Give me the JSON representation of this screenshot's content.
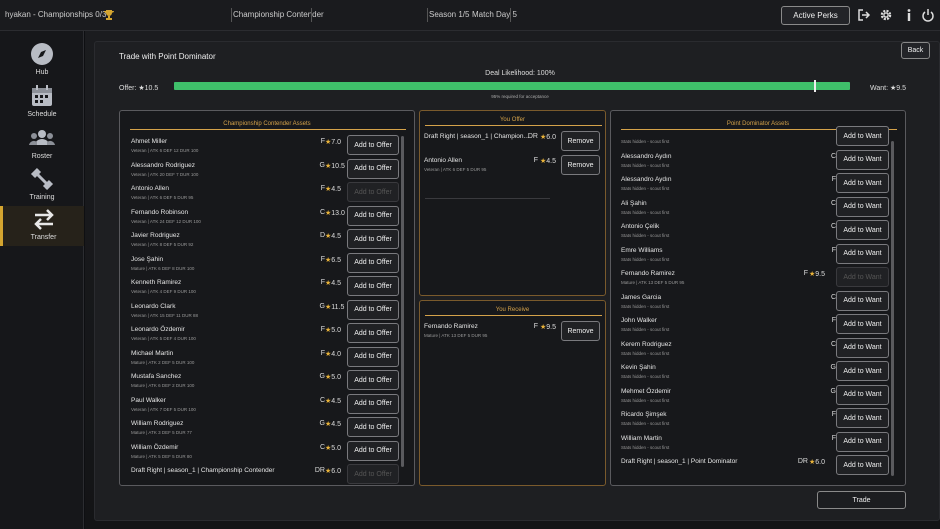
{
  "topbar": {
    "user": "hyakan - Championships 0/3",
    "club": "Championship Contender",
    "season": "Season 1/5",
    "matchday": "Match Day 5",
    "perks_label": "Active Perks"
  },
  "sidebar": [
    {
      "label": "Hub",
      "icon": "compass-icon"
    },
    {
      "label": "Schedule",
      "icon": "calendar-icon"
    },
    {
      "label": "Roster",
      "icon": "users-icon"
    },
    {
      "label": "Training",
      "icon": "dumbbell-icon"
    },
    {
      "label": "Transfer",
      "icon": "swap-arrows-icon",
      "active": true
    }
  ],
  "modal": {
    "title": "Trade with Point Dominator",
    "back_label": "Back",
    "likelihood": "Deal Likelihood: 100%",
    "likelihood_value": 1.0,
    "offer_label": "Offer: ★10.5",
    "want_label": "Want: ★9.5",
    "required_text": "95% required for acceptance",
    "required_value": 0.95,
    "trade_label": "Trade"
  },
  "left_panel": {
    "title": "Championship Contender Assets",
    "button_label": "Add to Offer",
    "rows": [
      {
        "name": "Ahmet Miller",
        "stats": "Veteran | ATK 6 DEF 12 DUR 100",
        "pos": "F",
        "rating": "★7.0",
        "disabled": false
      },
      {
        "name": "Alessandro Rodriguez",
        "stats": "Veteran | ATK 20 DEF 7 DUR 100",
        "pos": "G",
        "rating": "★10.5",
        "disabled": false
      },
      {
        "name": "Antonio Allen",
        "stats": "Veteran | ATK 6 DEF 5 DUR 95",
        "pos": "F",
        "rating": "★4.5",
        "disabled": true
      },
      {
        "name": "Fernando Robinson",
        "stats": "Veteran | ATK 24 DEF 12 DUR 100",
        "pos": "C",
        "rating": "★13.0",
        "disabled": false
      },
      {
        "name": "Javier Rodriguez",
        "stats": "Veteran | ATK 8 DEF 5 DUR 92",
        "pos": "D",
        "rating": "★4.5",
        "disabled": false
      },
      {
        "name": "Jose Şahin",
        "stats": "Mature | ATK 6 DEF 8 DUR 100",
        "pos": "F",
        "rating": "★6.5",
        "disabled": false
      },
      {
        "name": "Kenneth Ramirez",
        "stats": "Veteran | ATK 4 DEF 9 DUR 100",
        "pos": "F",
        "rating": "★4.5",
        "disabled": false
      },
      {
        "name": "Leonardo Clark",
        "stats": "Veteran | ATK 15 DEF 11 DUR 88",
        "pos": "G",
        "rating": "★11.5",
        "disabled": false
      },
      {
        "name": "Leonardo Özdemir",
        "stats": "Veteran | ATK 5 DEF 4 DUR 100",
        "pos": "F",
        "rating": "★5.0",
        "disabled": false
      },
      {
        "name": "Michael Martin",
        "stats": "Mature | ATK 2 DEF 5 DUR 100",
        "pos": "F",
        "rating": "★4.0",
        "disabled": false
      },
      {
        "name": "Mustafa Sanchez",
        "stats": "Mature | ATK 6 DEF 2 DUR 100",
        "pos": "G",
        "rating": "★5.0",
        "disabled": false
      },
      {
        "name": "Paul Walker",
        "stats": "Veteran | ATK 7 DEF 5 DUR 100",
        "pos": "C",
        "rating": "★4.5",
        "disabled": false
      },
      {
        "name": "William Rodriguez",
        "stats": "Mature | ATK 3 DEF 5 DUR 77",
        "pos": "G",
        "rating": "★4.5",
        "disabled": false
      },
      {
        "name": "William Özdemir",
        "stats": "Mature | ATK 5 DEF 5 DUR 80",
        "pos": "C",
        "rating": "★5.0",
        "disabled": false
      },
      {
        "name": "Draft Right | season_1 | Championship Contender",
        "stats": "",
        "pos": "DR",
        "rating": "★6.0",
        "disabled": true
      }
    ]
  },
  "offer_panel": {
    "title": "You Offer",
    "button_label": "Remove",
    "rows": [
      {
        "name": "Draft Right | season_1 | Champion...",
        "stats": "",
        "pos": "DR",
        "rating": "★6.0"
      },
      {
        "name": "Antonio Allen",
        "stats": "Veteran | ATK 6 DEF 5 DUR 95",
        "pos": "F",
        "rating": "★4.5"
      }
    ]
  },
  "receive_panel": {
    "title": "You Receive",
    "button_label": "Remove",
    "rows": [
      {
        "name": "Fernando Ramirez",
        "stats": "Mature | ATK 13 DEF 5 DUR 95",
        "pos": "F",
        "rating": "★9.5"
      }
    ]
  },
  "right_panel": {
    "title": "Point Dominator Assets",
    "button_label": "Add to Want",
    "rows": [
      {
        "name": "",
        "stats": "Stats hidden - scout first",
        "pos": "",
        "rating": "",
        "disabled": false
      },
      {
        "name": "Alessandro Aydın",
        "stats": "Stats hidden - scout first",
        "pos": "C",
        "rating": "",
        "disabled": false
      },
      {
        "name": "Alessandro Aydın",
        "stats": "Stats hidden - scout first",
        "pos": "F",
        "rating": "",
        "disabled": false
      },
      {
        "name": "Ali Şahin",
        "stats": "Stats hidden - scout first",
        "pos": "C",
        "rating": "",
        "disabled": false
      },
      {
        "name": "Antonio Çelik",
        "stats": "Stats hidden - scout first",
        "pos": "C",
        "rating": "",
        "disabled": false
      },
      {
        "name": "Emre Williams",
        "stats": "Stats hidden - scout first",
        "pos": "F",
        "rating": "",
        "disabled": false
      },
      {
        "name": "Fernando Ramirez",
        "stats": "Mature | ATK 13 DEF 5 DUR 95",
        "pos": "F",
        "rating": "★9.5",
        "disabled": true
      },
      {
        "name": "James Garcia",
        "stats": "Stats hidden - scout first",
        "pos": "C",
        "rating": "",
        "disabled": false
      },
      {
        "name": "John Walker",
        "stats": "Stats hidden - scout first",
        "pos": "F",
        "rating": "",
        "disabled": false
      },
      {
        "name": "Kerem Rodriguez",
        "stats": "Stats hidden - scout first",
        "pos": "C",
        "rating": "",
        "disabled": false
      },
      {
        "name": "Kevin Şahin",
        "stats": "Stats hidden - scout first",
        "pos": "G",
        "rating": "",
        "disabled": false
      },
      {
        "name": "Mehmet Özdemir",
        "stats": "Stats hidden - scout first",
        "pos": "G",
        "rating": "",
        "disabled": false
      },
      {
        "name": "Ricardo Şimşek",
        "stats": "Stats hidden - scout first",
        "pos": "F",
        "rating": "",
        "disabled": false
      },
      {
        "name": "William Martin",
        "stats": "Stats hidden - scout first",
        "pos": "F",
        "rating": "",
        "disabled": false
      },
      {
        "name": "Draft Right | season_1 | Point Dominator",
        "stats": "",
        "pos": "DR",
        "rating": "★6.0",
        "disabled": false
      }
    ]
  }
}
